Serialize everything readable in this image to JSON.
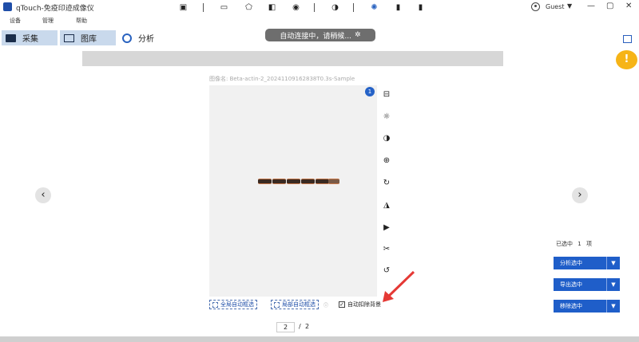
{
  "app": {
    "title": "qTouch-免疫印迹成像仪",
    "user": "Guest",
    "window_controls": [
      "—",
      "▢",
      "✕"
    ]
  },
  "menu": [
    "设备",
    "管理",
    "帮助"
  ],
  "tabs": [
    {
      "label": "采集",
      "icon": "camera-icon"
    },
    {
      "label": "图库",
      "icon": "gallery-icon"
    },
    {
      "label": "分析",
      "icon": "analysis-icon"
    }
  ],
  "status": {
    "text": "自动连接中，请稍候...",
    "icon": "spinner-icon"
  },
  "toolbar": {
    "icons": [
      "image-add-icon",
      "rectangle-select-icon",
      "polygon-select-icon",
      "compare-icon",
      "eye-icon",
      "contrast-icon",
      "auto-expose-icon",
      "bar-chart-icon",
      "barcode-icon"
    ]
  },
  "image": {
    "name_label": "图像名:",
    "name": "Beta-actin-2_20241109162838T0.3s-Sample",
    "badge": "1"
  },
  "side_tools": [
    "adjust-icon",
    "brightness-icon",
    "contrast-icon",
    "zoom-icon",
    "rotate-icon",
    "flip-vertical-icon",
    "flip-horizontal-icon",
    "crop-icon",
    "reset-icon"
  ],
  "actions": {
    "global_select": "全局自动框选",
    "local_select": "局部自动框选",
    "auto_bg": "自动扣除背景",
    "auto_bg_checked": true
  },
  "pagination": {
    "current": "2",
    "separator": "/",
    "total": "2"
  },
  "right_panel": {
    "selected_label": "已选中",
    "selected_count": "1",
    "selected_unit": "项",
    "buttons": [
      "分析选中",
      "导出选中",
      "移除选中"
    ]
  },
  "colors": {
    "accent": "#1f5ec9",
    "tab_bg": "#c9d9ec",
    "warning": "#f6b417",
    "arrow": "#e53935"
  }
}
